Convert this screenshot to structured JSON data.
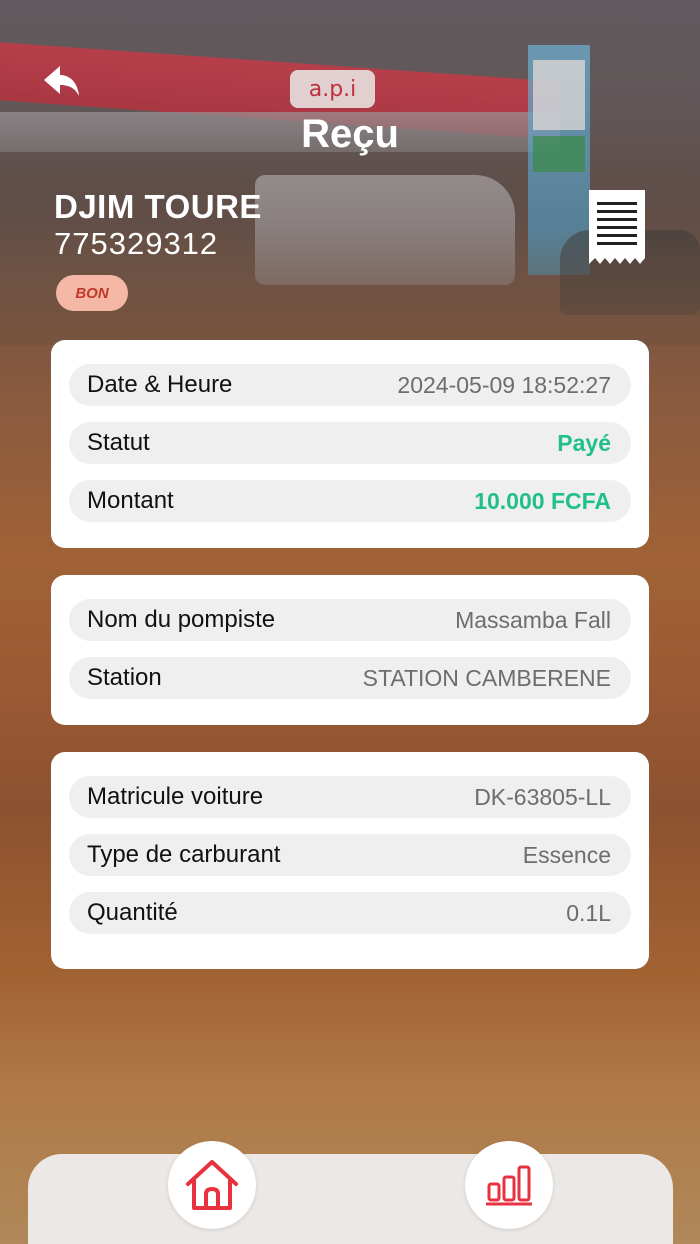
{
  "header": {
    "title": "Reçu",
    "back_icon": "back-arrow-icon",
    "receipt_icon": "receipt-icon"
  },
  "user": {
    "name": "DJIM TOURE",
    "phone": "775329312",
    "badge": "BON"
  },
  "hero": {
    "sign_text": "a.p.i"
  },
  "cards": {
    "transaction": {
      "date_label": "Date & Heure",
      "date_value": "2024-05-09 18:52:27",
      "status_label": "Statut",
      "status_value": "Payé",
      "amount_label": "Montant",
      "amount_value": "10.000 FCFA"
    },
    "station": {
      "attendant_label": "Nom du pompiste",
      "attendant_value": "Massamba Fall",
      "station_label": "Station",
      "station_value": "STATION CAMBERENE"
    },
    "vehicle": {
      "plate_label": "Matricule voiture",
      "plate_value": "DK-63805-LL",
      "fuel_label": "Type de carburant",
      "fuel_value": "Essence",
      "qty_label": "Quantité",
      "qty_value": "0.1L"
    }
  },
  "nav": {
    "home_icon": "home-icon",
    "stats_icon": "bar-chart-icon"
  },
  "colors": {
    "accent_red": "#e8323f",
    "paid_green": "#21c08b",
    "badge_bg": "#f5b8a6",
    "badge_text": "#c0392b"
  }
}
